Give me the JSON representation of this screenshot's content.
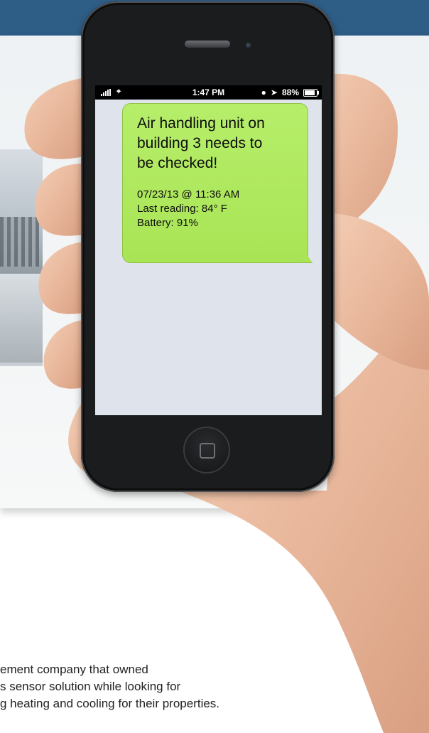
{
  "status_bar": {
    "time": "1:47 PM",
    "battery": "88%",
    "battery_level": 0.88,
    "icons": [
      "signal-icon",
      "wifi-icon",
      "lock-rotation-icon",
      "location-arrow-icon",
      "battery-icon"
    ]
  },
  "message": {
    "title_lines": [
      "Air handling unit on",
      "building 3 needs to",
      "be checked!"
    ],
    "details": [
      "07/23/13 @ 11:36 AM",
      "Last reading: 84° F",
      "Battery: 91%"
    ]
  },
  "body_text": {
    "lines": [
      "ement company that owned",
      "s sensor solution while looking for",
      "g heating and cooling for their properties."
    ]
  },
  "colors": {
    "banner": "#2e5d86",
    "bubble": "#a9e455",
    "screen": "#dfe4ec"
  }
}
